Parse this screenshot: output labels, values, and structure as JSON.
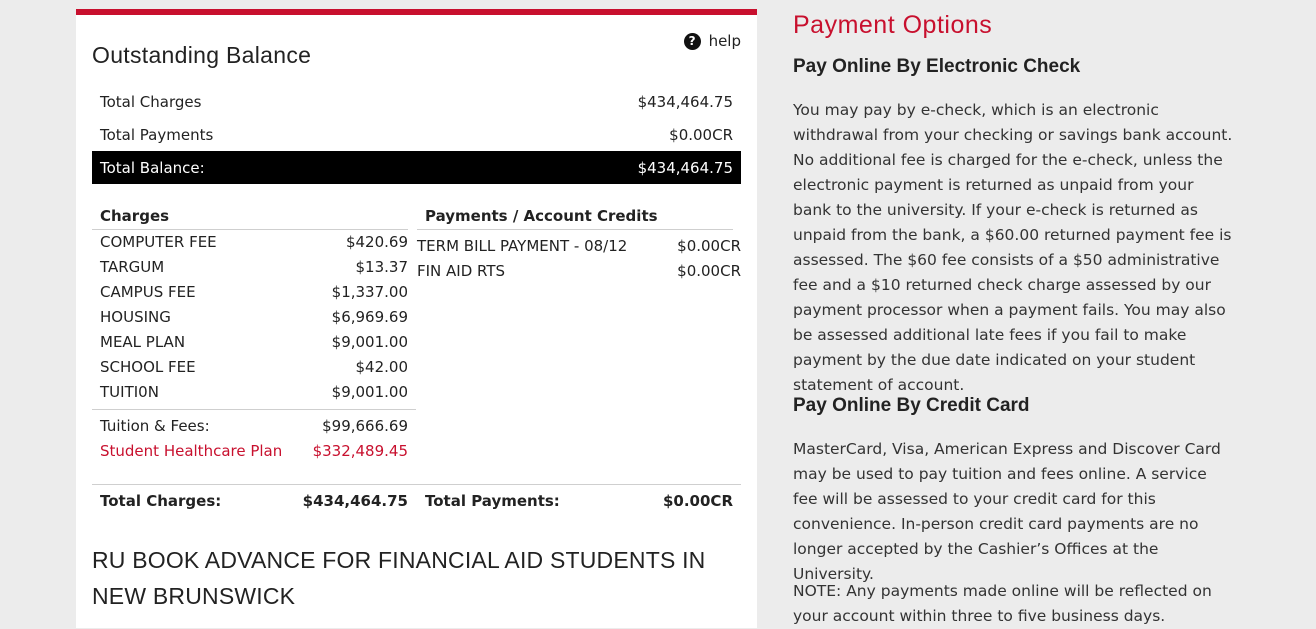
{
  "outstanding": {
    "title": "Outstanding Balance",
    "help_label": "help",
    "summary": {
      "total_charges_label": "Total Charges",
      "total_charges_value": "$434,464.75",
      "total_payments_label": "Total Payments",
      "total_payments_value": "$0.00CR",
      "total_balance_label": "Total Balance:",
      "total_balance_value": "$434,464.75"
    },
    "charges_header": "Charges",
    "payments_header": "Payments / Account Credits",
    "charges": [
      {
        "label": "COMPUTER FEE",
        "value": "$420.69"
      },
      {
        "label": "TARGUM",
        "value": "$13.37"
      },
      {
        "label": "CAMPUS FEE",
        "value": "$1,337.00"
      },
      {
        "label": "HOUSING",
        "value": "$6,969.69"
      },
      {
        "label": "MEAL PLAN",
        "value": "$9,001.00"
      },
      {
        "label": "SCHOOL FEE",
        "value": "$42.00"
      },
      {
        "label": "TUITI0N",
        "value": "$9,001.00"
      }
    ],
    "tuition_fees_label": "Tuition & Fees:",
    "tuition_fees_value": "$99,666.69",
    "healthcare_label": "Student Healthcare Plan",
    "healthcare_value": "$332,489.45",
    "payments": [
      {
        "label": "TERM BILL PAYMENT - 08/12",
        "value": "$0.00CR"
      },
      {
        "label": "FIN AID RTS",
        "value": "$0.00CR"
      }
    ],
    "footer": {
      "total_charges_label": "Total Charges:",
      "total_charges_value": "$434,464.75",
      "total_payments_label": "Total Payments:",
      "total_payments_value": "$0.00CR"
    },
    "book_advance_title": "RU BOOK ADVANCE FOR FINANCIAL AID STUDENTS IN NEW BRUNSWICK"
  },
  "payment_options": {
    "title": "Payment Options",
    "echeck_heading": "Pay Online By Electronic Check",
    "echeck_text": "You may pay by e-check, which is an electronic withdrawal from your checking or savings bank account. No additional fee is charged for the e-check, unless the electronic payment is returned as unpaid from your bank to the university. If your e-check is returned as unpaid from the bank, a $60.00 returned payment fee is assessed. The $60 fee consists of a $50 administrative fee and a $10 returned check charge assessed by our payment processor when a payment fails. You may also be assessed additional late fees if you fail to make payment by the due date indicated on your student statement of account.",
    "card_heading": "Pay Online By Credit Card",
    "card_text": "MasterCard, Visa, American Express and Discover Card may be used to pay tuition and fees online. A service fee will be assessed to your credit card for this convenience. In-person credit card payments are no longer accepted by the Cashier’s Offices at the University.",
    "note_text": "NOTE: Any payments made online will be reflected on your account within three to five business days."
  },
  "colors": {
    "accent": "#c8102e",
    "total_bar": "#000000",
    "page_bg": "#ececec"
  }
}
